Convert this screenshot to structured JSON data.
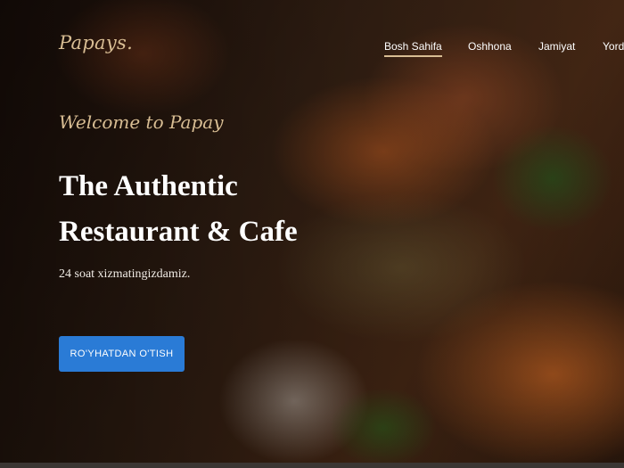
{
  "brand": {
    "name": "Papays."
  },
  "nav": {
    "items": [
      {
        "label": "Bosh Sahifa",
        "active": true
      },
      {
        "label": "Oshhona",
        "active": false
      },
      {
        "label": "Jamiyat",
        "active": false
      },
      {
        "label": "Yord",
        "active": false
      }
    ]
  },
  "hero": {
    "welcome": "Welcome to Papay",
    "headline_line1": "The Authentic",
    "headline_line2": "Restaurant & Cafe",
    "subtitle": "24 soat xizmatingizdamiz.",
    "cta_label": "RO'YHATDAN O'TISH"
  },
  "colors": {
    "accent_gold": "#d8bd93",
    "cta_blue": "#2a7bd6",
    "text_white": "#ffffff"
  }
}
